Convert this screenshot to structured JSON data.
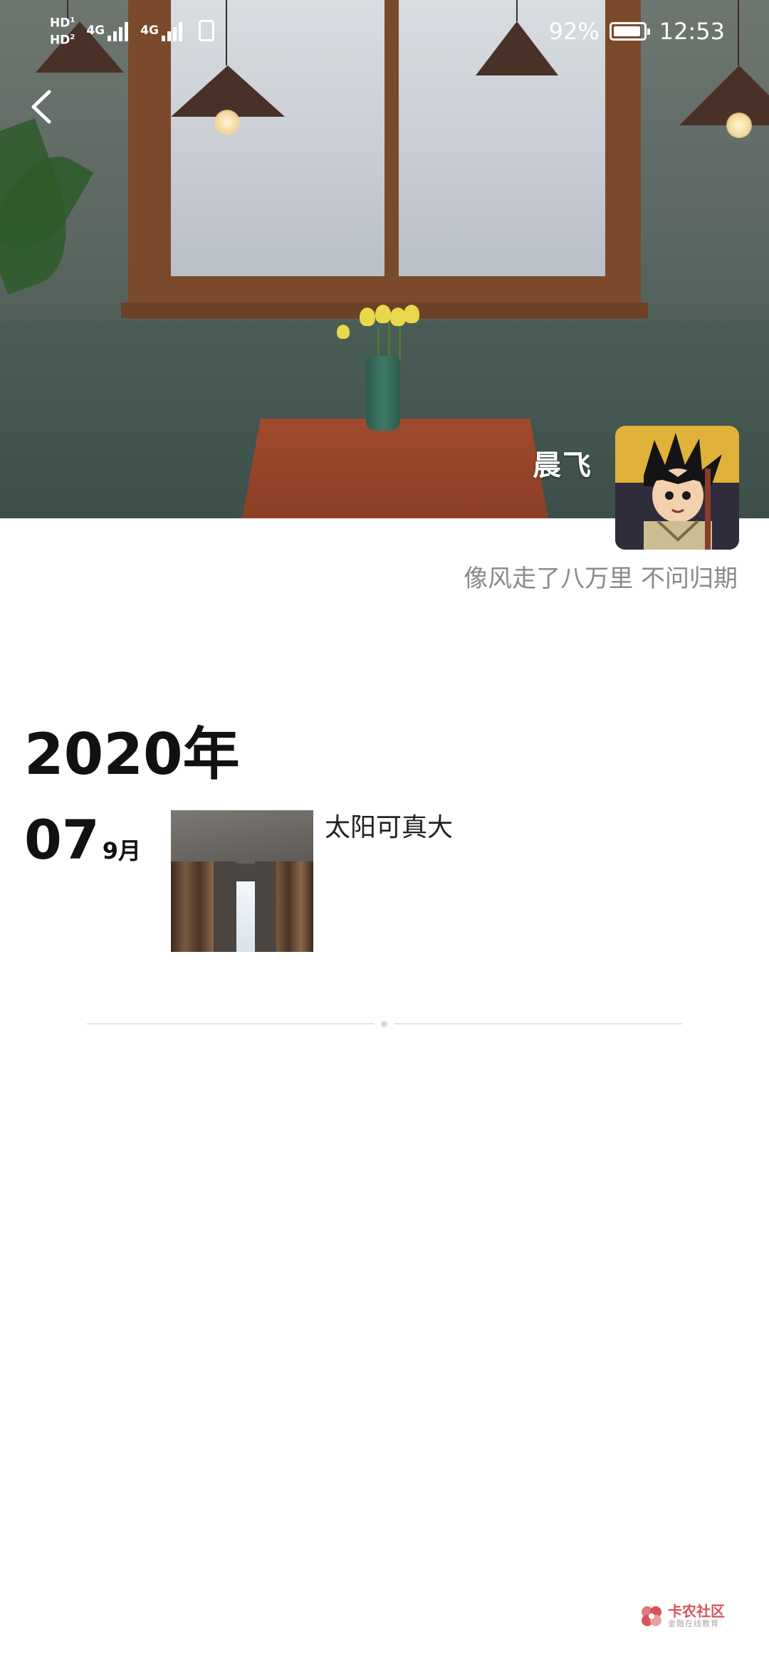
{
  "status_bar": {
    "hd1": "HD",
    "hd1_sim": "1",
    "hd2": "HD",
    "hd2_sim": "2",
    "network1": "4G",
    "network2": "4G",
    "battery_percent": "92%",
    "battery_level": 0.92,
    "time": "12:53"
  },
  "profile": {
    "name": "晨飞",
    "signature": "像风走了八万里 不问归期",
    "cover_image": "cafe-window-table-photo",
    "avatar_image": "cartoon-boy-avatar"
  },
  "timeline": {
    "year": "2020年",
    "posts": [
      {
        "day": "07",
        "month": "9月",
        "image": "window-curtain-photo",
        "text": "太阳可真大"
      }
    ]
  },
  "watermark": {
    "title": "卡农社区",
    "subtitle": "金融在线教育",
    "brand_color": "#d8545a"
  },
  "icons": {
    "back": "chevron-left-icon",
    "battery": "battery-icon",
    "vibrate": "vibrate-icon",
    "signal": "signal-icon"
  }
}
